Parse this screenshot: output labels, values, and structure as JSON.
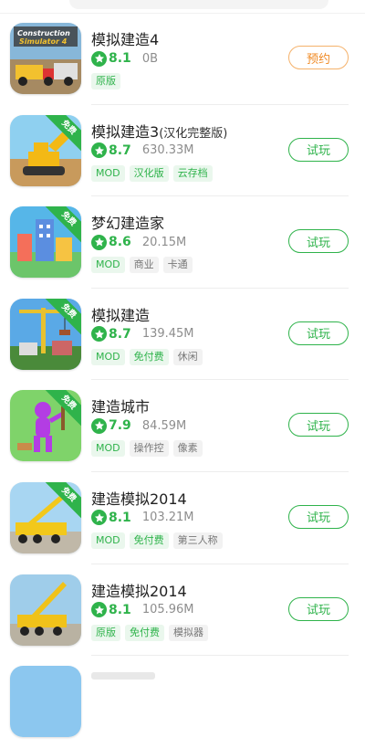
{
  "colors": {
    "accent": "#2fb34b",
    "reserve": "#f08a24"
  },
  "apps": [
    {
      "name": "模拟建造4",
      "subtitle": "",
      "rating": "8.1",
      "size": "0B",
      "tags": [
        {
          "text": "原版",
          "style": "green"
        }
      ],
      "button": "预约",
      "button_style": "orange",
      "free_badge": ""
    },
    {
      "name": "模拟建造3",
      "subtitle": "(汉化完整版)",
      "rating": "8.7",
      "size": "630.33M",
      "tags": [
        {
          "text": "MOD",
          "style": "green"
        },
        {
          "text": "汉化版",
          "style": "green"
        },
        {
          "text": "云存档",
          "style": "green"
        }
      ],
      "button": "试玩",
      "button_style": "green",
      "free_badge": "免费"
    },
    {
      "name": "梦幻建造家",
      "subtitle": "",
      "rating": "8.6",
      "size": "20.15M",
      "tags": [
        {
          "text": "MOD",
          "style": "green"
        },
        {
          "text": "商业",
          "style": "gray"
        },
        {
          "text": "卡通",
          "style": "gray"
        }
      ],
      "button": "试玩",
      "button_style": "green",
      "free_badge": "免费"
    },
    {
      "name": "模拟建造",
      "subtitle": "",
      "rating": "8.7",
      "size": "139.45M",
      "tags": [
        {
          "text": "MOD",
          "style": "green"
        },
        {
          "text": "免付费",
          "style": "green"
        },
        {
          "text": "休闲",
          "style": "gray"
        }
      ],
      "button": "试玩",
      "button_style": "green",
      "free_badge": "免费"
    },
    {
      "name": "建造城市",
      "subtitle": "",
      "rating": "7.9",
      "size": "84.59M",
      "tags": [
        {
          "text": "MOD",
          "style": "green"
        },
        {
          "text": "操作控",
          "style": "gray"
        },
        {
          "text": "像素",
          "style": "gray"
        }
      ],
      "button": "试玩",
      "button_style": "green",
      "free_badge": "免费"
    },
    {
      "name": "建造模拟2014",
      "subtitle": "",
      "rating": "8.1",
      "size": "103.21M",
      "tags": [
        {
          "text": "MOD",
          "style": "green"
        },
        {
          "text": "免付费",
          "style": "green"
        },
        {
          "text": "第三人称",
          "style": "gray"
        }
      ],
      "button": "试玩",
      "button_style": "green",
      "free_badge": "免费"
    },
    {
      "name": "建造模拟2014",
      "subtitle": "",
      "rating": "8.1",
      "size": "105.96M",
      "tags": [
        {
          "text": "原版",
          "style": "green"
        },
        {
          "text": "免付费",
          "style": "green"
        },
        {
          "text": "模拟器",
          "style": "gray"
        }
      ],
      "button": "试玩",
      "button_style": "green",
      "free_badge": ""
    }
  ]
}
